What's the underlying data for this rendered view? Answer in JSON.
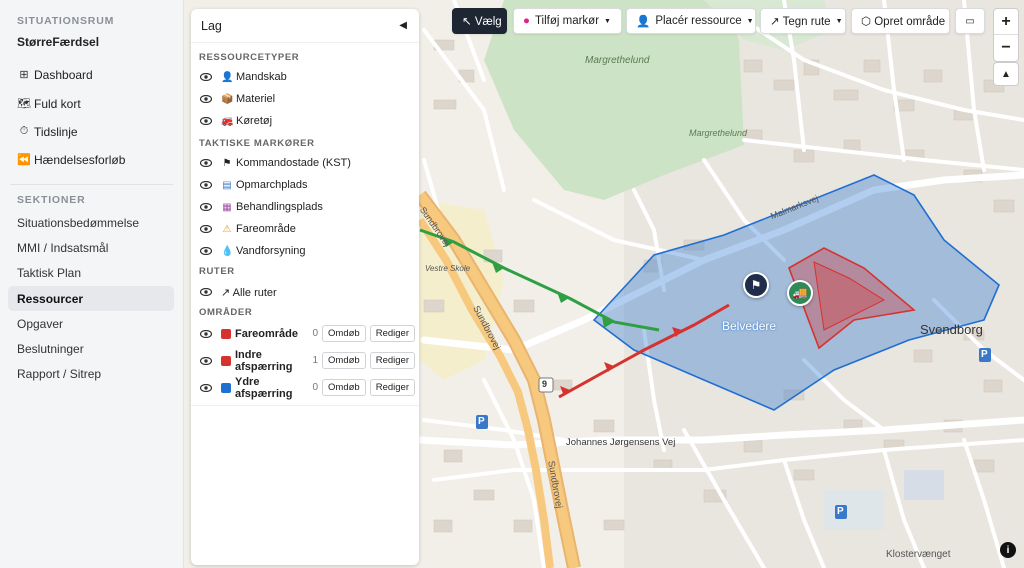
{
  "sidebar": {
    "title": "SITUATIONSRUM",
    "app_name": "StørreFærdsel",
    "nav": [
      {
        "label": "Dashboard",
        "icon": "grid-icon"
      },
      {
        "label": "Fuld kort",
        "icon": "map-icon"
      },
      {
        "label": "Tidslinje",
        "icon": "timer-icon"
      },
      {
        "label": "Hændelsesforløb",
        "icon": "rewind-icon"
      }
    ],
    "sections_title": "SEKTIONER",
    "sections": [
      {
        "label": "Situationsbedømmelse",
        "active": false
      },
      {
        "label": "MMI / Indsatsmål",
        "active": false
      },
      {
        "label": "Taktisk Plan",
        "active": false
      },
      {
        "label": "Ressourcer",
        "active": true
      },
      {
        "label": "Opgaver",
        "active": false
      },
      {
        "label": "Beslutninger",
        "active": false
      },
      {
        "label": "Rapport / Sitrep",
        "active": false
      }
    ]
  },
  "layers": {
    "title": "Lag",
    "resource_types_title": "RESSOURCETYPER",
    "resource_types": [
      {
        "label": "Mandskab",
        "icon": "person-icon",
        "glyph": "👤"
      },
      {
        "label": "Materiel",
        "icon": "box-icon",
        "glyph": "📦"
      },
      {
        "label": "Køretøj",
        "icon": "vehicle-icon",
        "glyph": "🚒"
      }
    ],
    "tactical_title": "TAKTISKE MARKØRER",
    "tactical": [
      {
        "label": "Kommandostade (KST)",
        "icon": "flag-icon",
        "glyph": "⚑"
      },
      {
        "label": "Opmarchplads",
        "icon": "parking-icon",
        "glyph": "▤"
      },
      {
        "label": "Behandlingsplads",
        "icon": "medical-icon",
        "glyph": "▦"
      },
      {
        "label": "Fareområde",
        "icon": "warning-icon",
        "glyph": "⚠"
      },
      {
        "label": "Vandforsyning",
        "icon": "droplet-icon",
        "glyph": "💧"
      }
    ],
    "routes_title": "RUTER",
    "routes_all": "↗ Alle ruter",
    "areas_title": "OMRÅDER",
    "areas": [
      {
        "name": "Fareområde",
        "count": "0",
        "color": "#d6322e",
        "rename": "Omdøb",
        "edit": "Rediger"
      },
      {
        "name": "Indre afspærring",
        "count": "1",
        "color": "#d6322e",
        "rename": "Omdøb",
        "edit": "Rediger"
      },
      {
        "name": "Ydre afspærring",
        "count": "0",
        "color": "#1f6fd1",
        "rename": "Omdøb",
        "edit": "Rediger"
      }
    ]
  },
  "toolbar": {
    "select": "↖ Vælg",
    "add_marker": "Tilføj markør",
    "place_resource": "Placér ressource",
    "draw_route": "↗ Tegn rute",
    "create_area": "⬡ Opret område"
  },
  "map": {
    "labels": {
      "park": "Margrethelund",
      "park2": "Margrethelund",
      "belvedere": "Belvedere",
      "svendborg": "Svendborg",
      "sundbrovej": "Sundbrovej",
      "sundbrovej2": "Sundbrovej",
      "sundbrovej3": "Sundbrovej",
      "johannes": "Johannes Jørgensens Vej",
      "klostervaenget": "Klostervænget",
      "vestre_skole": "Vestre Skole",
      "malmarksvej": "Malmarksvej",
      "route9": "9"
    },
    "colors": {
      "outer_cordon": "#1f6fd1",
      "inner_cordon": "#d6322e",
      "route_green": "#2ea043",
      "route_red": "#d6322e"
    }
  }
}
